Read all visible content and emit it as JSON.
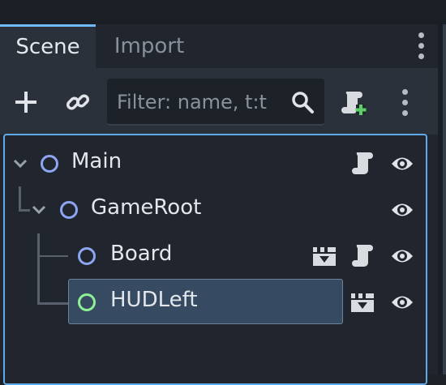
{
  "tabs": {
    "scene": "Scene",
    "import": "Import"
  },
  "toolbar": {
    "filter_placeholder": "Filter: name, t:t",
    "icons": [
      "add-icon",
      "link-icon",
      "search-icon",
      "attach-script-icon",
      "more-vertical-icon"
    ]
  },
  "tree": {
    "nodes": [
      {
        "label": "Main",
        "depth": 0,
        "icons": [
          "script-icon",
          "visibility-eye-icon"
        ]
      },
      {
        "label": "GameRoot",
        "depth": 1,
        "icons": [
          "visibility-eye-icon"
        ]
      },
      {
        "label": "Board",
        "depth": 2,
        "icons": [
          "instance-scene-icon",
          "script-icon",
          "visibility-eye-icon"
        ]
      },
      {
        "label": "HUDLeft",
        "depth": 2,
        "selected": true,
        "icons": [
          "instance-scene-icon",
          "visibility-eye-icon"
        ]
      }
    ]
  },
  "colors": {
    "accent": "#70bafa",
    "node_ring": "#8da5f3",
    "node_ring_selected": "#8eef97",
    "selection": "#364b61"
  }
}
